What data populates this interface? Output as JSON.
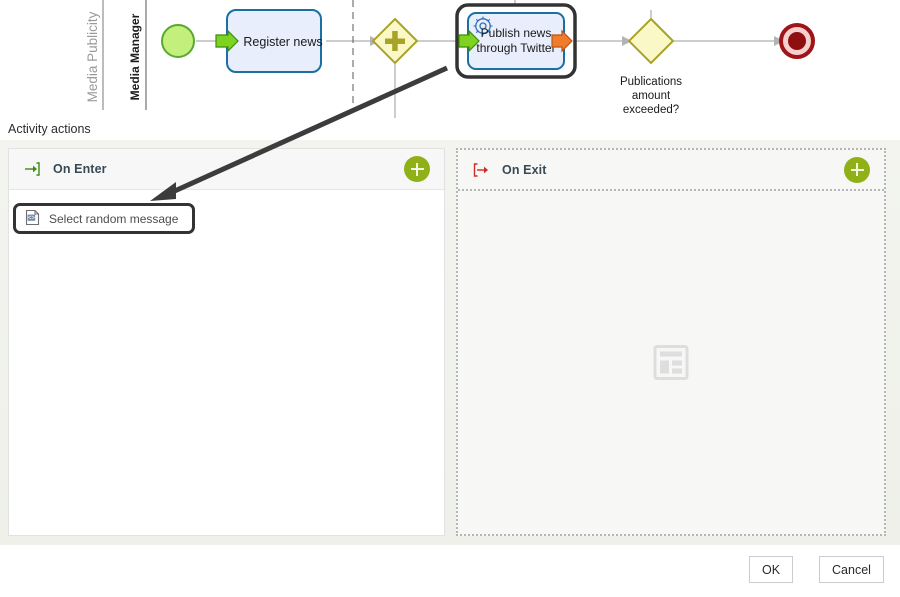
{
  "section": {
    "label": "Activity actions"
  },
  "diagram": {
    "pool_label": "Media Publicity",
    "lane_label": "Media Manager",
    "nodes": {
      "start_event": {
        "name": "start-event",
        "label": ""
      },
      "task_register": {
        "label": "Register news"
      },
      "gateway_parallel": {
        "label": ""
      },
      "task_publish": {
        "label_line1": "Publish  news",
        "label_line2": "through Twitter",
        "selected": true
      },
      "gateway_exclusive": {
        "label_line1": "Publications",
        "label_line2": "amount",
        "label_line3": "exceeded?"
      },
      "end_event": {
        "label": ""
      }
    },
    "colors": {
      "task_fill": "#e8eefc",
      "task_border": "#1a6fa3",
      "start_fill": "#c3ef7c",
      "start_border": "#5aa82e",
      "end_fill": "#8d0f10",
      "end_border": "#9e1418",
      "gateway_fill": "#fbf8c8",
      "gateway_border": "#a8a225",
      "arrow_green": "#6db33f",
      "arrow_orange": "#e2692a",
      "selection": "#333333"
    }
  },
  "on_enter": {
    "title": "On Enter",
    "icon": "enter-arrow-icon",
    "add_label": "+",
    "items": [
      {
        "label": "Select random message",
        "icon": "script-code-icon",
        "selected": true
      }
    ]
  },
  "on_exit": {
    "title": "On Exit",
    "icon": "exit-arrow-icon",
    "add_label": "+",
    "items": [],
    "placeholder_icon": "empty-layout-placeholder-icon"
  },
  "footer": {
    "ok_label": "OK",
    "cancel_label": "Cancel"
  }
}
